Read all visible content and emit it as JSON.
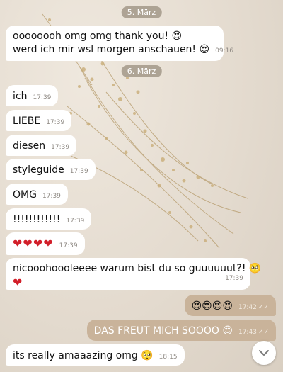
{
  "dates": [
    "5. März",
    "6. März"
  ],
  "messages": [
    {
      "dir": "in",
      "text": "oooooooh omg omg thank you! 😍",
      "text2": "werd ich mir wsl morgen anschauen! 😍",
      "time": "09:16"
    },
    {
      "dir": "in",
      "text": "ich",
      "time": "17:39"
    },
    {
      "dir": "in",
      "text": "LIEBE",
      "time": "17:39"
    },
    {
      "dir": "in",
      "text": "diesen",
      "time": "17:39"
    },
    {
      "dir": "in",
      "text": "styleguide",
      "time": "17:39"
    },
    {
      "dir": "in",
      "text": "OMG",
      "time": "17:39"
    },
    {
      "dir": "in",
      "text": "!!!!!!!!!!!!",
      "time": "17:39"
    },
    {
      "dir": "in",
      "text": "❤❤❤❤",
      "time": "17:39"
    },
    {
      "dir": "in",
      "text": "nicooohoooleeee warum bist du so guuuuuut?! 🥺",
      "text2": "❤",
      "time": "17:39"
    },
    {
      "dir": "out",
      "text": "😍😍😍😍",
      "time": "17:42"
    },
    {
      "dir": "out",
      "text": "DAS FREUT MICH SOOOO 😍",
      "time": "17:43"
    },
    {
      "dir": "in",
      "text": "its really amaaazing omg 🥺",
      "time": "18:15"
    }
  ],
  "colors": {
    "incoming": "#ffffff",
    "outgoing": "#c9b39a",
    "heart": "#d21f2a"
  },
  "icons": {
    "read_receipt": "double-check-icon",
    "scroll_down": "chevron-down-icon"
  }
}
